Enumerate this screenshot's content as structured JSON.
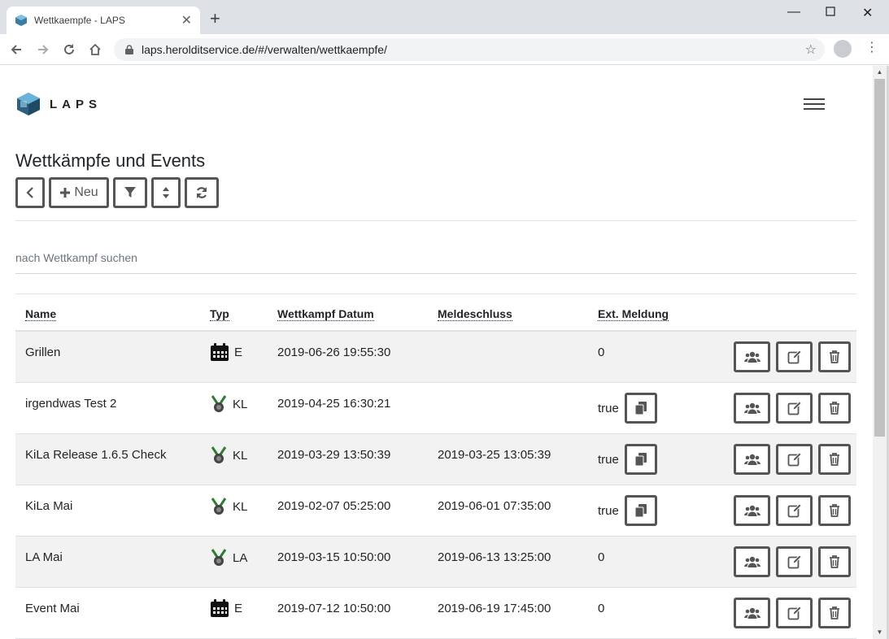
{
  "browser": {
    "tab_title": "Wettkaempfe - LAPS",
    "url": "laps.herolditservice.de/#/verwalten/wettkaempfe/"
  },
  "app": {
    "brand": "LAPS",
    "page_title": "Wettkämpfe und Events",
    "toolbar": {
      "new_label": "Neu"
    },
    "search": {
      "placeholder": "nach Wettkampf suchen"
    }
  },
  "table": {
    "headers": {
      "name": "Name",
      "typ": "Typ",
      "datum": "Wettkampf Datum",
      "meldeschluss": "Meldeschluss",
      "ext": "Ext. Meldung"
    },
    "rows": [
      {
        "name": "Grillen",
        "typ_icon": "calendar-icon",
        "typ": "E",
        "datum": "2019-06-26 19:55:30",
        "meldeschluss": "",
        "ext": "0"
      },
      {
        "name": "irgendwas Test 2",
        "typ_icon": "medal-icon",
        "typ": "KL",
        "datum": "2019-04-25 16:30:21",
        "meldeschluss": "",
        "ext": "true"
      },
      {
        "name": "KiLa Release 1.6.5 Check",
        "typ_icon": "medal-icon",
        "typ": "KL",
        "datum": "2019-03-29 13:50:39",
        "meldeschluss": "2019-03-25 13:05:39",
        "ext": "true"
      },
      {
        "name": "KiLa Mai",
        "typ_icon": "medal-icon",
        "typ": "KL",
        "datum": "2019-02-07 05:25:00",
        "meldeschluss": "2019-06-01 07:35:00",
        "ext": "true"
      },
      {
        "name": "LA Mai",
        "typ_icon": "medal-icon",
        "typ": "LA",
        "datum": "2019-03-15 10:50:00",
        "meldeschluss": "2019-06-13 13:25:00",
        "ext": "0"
      },
      {
        "name": "Event Mai",
        "typ_icon": "calendar-icon",
        "typ": "E",
        "datum": "2019-07-12 10:50:00",
        "meldeschluss": "2019-06-19 17:45:00",
        "ext": "0"
      }
    ]
  },
  "colors": {
    "button_border": "#555555",
    "row_stripe": "#f2f2f2",
    "medal_green": "#2e7d32"
  }
}
